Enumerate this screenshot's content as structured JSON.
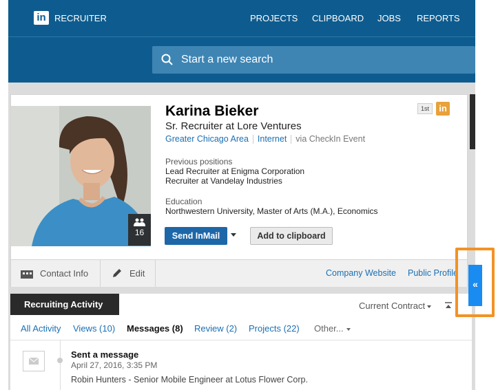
{
  "header": {
    "brand": "RECRUITER",
    "logo": "in",
    "nav": [
      "PROJECTS",
      "CLIPBOARD",
      "JOBS",
      "REPORTS"
    ],
    "search_placeholder": "Start a new search"
  },
  "profile": {
    "name": "Karina Bieker",
    "headline": "Sr. Recruiter at Lore Ventures",
    "location": "Greater Chicago Area",
    "industry": "Internet",
    "source": "via CheckIn Event",
    "previous_label": "Previous positions",
    "previous": [
      "Lead Recruiter at Enigma Corporation",
      "Recruiter at Vandelay Industries"
    ],
    "education_label": "Education",
    "education": "Northwestern University, Master of Arts (M.A.), Economics",
    "connections": "16",
    "degree": "1st",
    "li_badge": "in",
    "send_inmail": "Send InMail",
    "add_to_clipboard": "Add to clipboard"
  },
  "actions": {
    "contact_info": "Contact Info",
    "edit": "Edit",
    "company_website": "Company Website",
    "public_profile": "Public Profile"
  },
  "activity": {
    "tab_title": "Recruiting Activity",
    "filter": "Current Contract",
    "tabs": [
      "All Activity",
      "Views (10)",
      "Messages (8)",
      "Review (2)",
      "Projects (22)",
      "Other..."
    ],
    "active_tab": "Messages (8)",
    "item": {
      "title": "Sent a message",
      "date": "April 27, 2016, 3:35 PM",
      "body": "Robin Hunters - Senior Mobile Engineer at Lotus Flower Corp."
    }
  },
  "side_button": "«",
  "colors": {
    "navbar": "#0e5c8f",
    "link": "#1a6fb3",
    "inmail_button": "#1d67a8",
    "side_button": "#1a8bf0",
    "highlight": "#f39224"
  }
}
